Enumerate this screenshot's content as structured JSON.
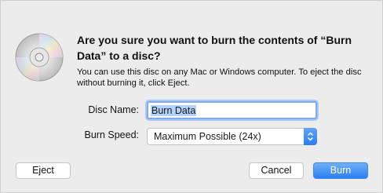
{
  "dialog": {
    "title": "Are you sure you want to burn the contents of “Burn Data” to a disc?",
    "message": "You can use this disc on any Mac or Windows computer. To eject the disc without burning it, click Eject.",
    "icon": "cd-disc-icon",
    "icon_label": "CD"
  },
  "form": {
    "disc_name_label": "Disc Name:",
    "disc_name_value": "Burn Data",
    "burn_speed_label": "Burn Speed:",
    "burn_speed_value": "Maximum Possible (24x)"
  },
  "buttons": {
    "eject": "Eject",
    "cancel": "Cancel",
    "burn": "Burn"
  },
  "colors": {
    "accent": "#2c7ff2",
    "dialog_bg": "#ececec",
    "selection": "#b3d2fa"
  }
}
